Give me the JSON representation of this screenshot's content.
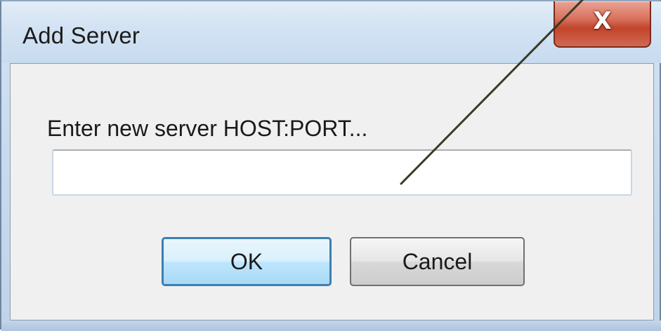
{
  "window": {
    "title": "Add Server",
    "close_glyph": "X"
  },
  "form": {
    "prompt": "Enter new server HOST:PORT...",
    "host_port_value": ""
  },
  "buttons": {
    "ok_label": "OK",
    "cancel_label": "Cancel"
  },
  "colors": {
    "accent": "#3c7fb1",
    "close_button": "#c2442b",
    "annotation_line": "#3a3a28"
  },
  "annotation": {
    "icon": "pointer-line"
  }
}
